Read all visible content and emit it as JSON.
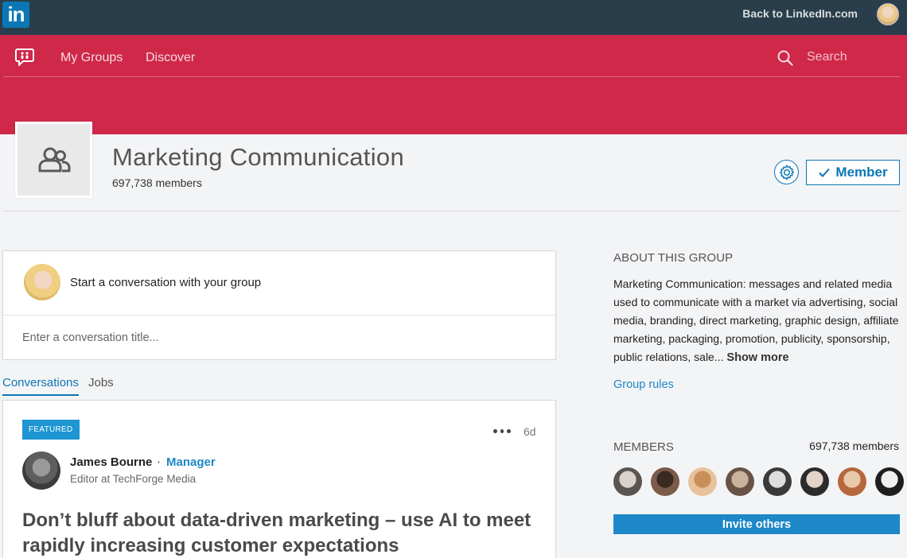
{
  "topbar": {
    "logo_text": "in",
    "back_link": "Back to LinkedIn.com"
  },
  "nav": {
    "my_groups": "My Groups",
    "discover": "Discover",
    "search_placeholder": "Search"
  },
  "group": {
    "title": "Marketing Communication",
    "members": "697,738 members",
    "member_button": "Member"
  },
  "compose": {
    "prompt": "Start a conversation with your group",
    "title_placeholder": "Enter a conversation title..."
  },
  "tabs": [
    {
      "label": "Conversations",
      "active": true
    },
    {
      "label": "Jobs",
      "active": false
    }
  ],
  "post": {
    "badge": "FEATURED",
    "time": "6d",
    "author_name": "James Bourne",
    "author_separator": "·",
    "author_role": "Manager",
    "author_title": "Editor at TechForge Media",
    "headline": "Don’t bluff about data-driven marketing – use AI to meet rapidly increasing customer expectations"
  },
  "sidebar": {
    "about_heading": "ABOUT THIS GROUP",
    "about_text": "Marketing Communication: messages and related media used to communicate with a market via advertising, social media, branding, direct marketing, graphic design, affiliate marketing, packaging, promotion, publicity, sponsorship, public relations, sale...",
    "show_more": "Show more",
    "group_rules": "Group rules",
    "members_heading": "MEMBERS",
    "members_count": "697,738 members",
    "member_avatars": [
      {
        "colors": [
          "#d9d2cc",
          "#5a5550"
        ]
      },
      {
        "colors": [
          "#3a2a22",
          "#7a5a48"
        ]
      },
      {
        "colors": [
          "#c98f5a",
          "#e7c29a"
        ]
      },
      {
        "colors": [
          "#c9b29e",
          "#6a5346"
        ]
      },
      {
        "colors": [
          "#dedede",
          "#3a3a3a"
        ]
      },
      {
        "colors": [
          "#e3d3c8",
          "#2b2b2b"
        ]
      },
      {
        "colors": [
          "#e9c9a8",
          "#b5673d"
        ]
      },
      {
        "colors": [
          "#f0f0f0",
          "#1e1e1e"
        ]
      }
    ],
    "invite_button": "Invite others"
  },
  "colors": {
    "linkedin_blue": "#0b77b5",
    "group_red": "#cf2849",
    "topbar": "#293e4a",
    "badge_blue": "#1d96d1"
  }
}
